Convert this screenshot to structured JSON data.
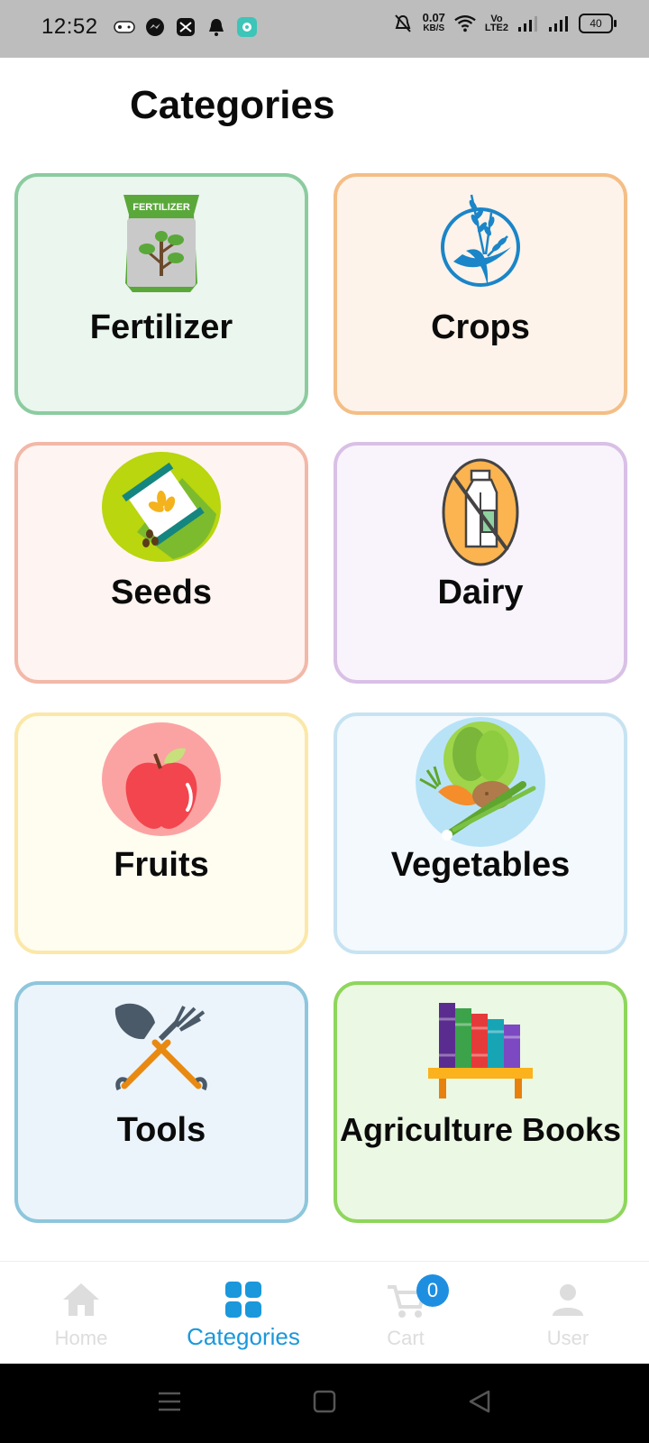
{
  "status_bar": {
    "time": "12:52",
    "net_speed_value": "0.07",
    "net_speed_unit": "KB/S",
    "volte_1": "Vo",
    "volte_2": "LTE2",
    "battery": "40"
  },
  "page": {
    "title": "Categories"
  },
  "categories": [
    {
      "label": "Fertilizer",
      "icon": "fertilizer-bag-icon",
      "art_text": "FERTILIZER",
      "border": "#8ccba0",
      "bg": "#eaf6ee"
    },
    {
      "label": "Crops",
      "icon": "wheat-icon",
      "border": "#f4be86",
      "bg": "#fdf3ea"
    },
    {
      "label": "Seeds",
      "icon": "seed-packet-icon",
      "border": "#f2b8a8",
      "bg": "#fef4f1"
    },
    {
      "label": "Dairy",
      "icon": "milk-carton-icon",
      "border": "#d9c0e6",
      "bg": "#f9f4fc"
    },
    {
      "label": "Fruits",
      "icon": "apple-icon",
      "border": "#fbe8a8",
      "bg": "#fffcf0"
    },
    {
      "label": "Vegetables",
      "icon": "vegetables-icon",
      "border": "#c7e3f2",
      "bg": "#f4f9fd"
    },
    {
      "label": "Tools",
      "icon": "shovel-fork-icon",
      "border": "#8ec6dc",
      "bg": "#ebf4fb"
    },
    {
      "label": "Agriculture Books",
      "icon": "bookshelf-icon",
      "border": "#8ed65c",
      "bg": "#ebf8e3"
    }
  ],
  "bottom_nav": {
    "active": "Categories",
    "items": [
      {
        "label": "Home",
        "icon": "home-icon"
      },
      {
        "label": "Categories",
        "icon": "grid-icon"
      },
      {
        "label": "Cart",
        "icon": "cart-icon",
        "badge": "0"
      },
      {
        "label": "User",
        "icon": "user-icon"
      }
    ]
  },
  "colors": {
    "accent": "#1a98db",
    "badge": "#1e8fe0",
    "inactive_nav": "#dddddd",
    "status_bar": "#bdbdbd"
  }
}
